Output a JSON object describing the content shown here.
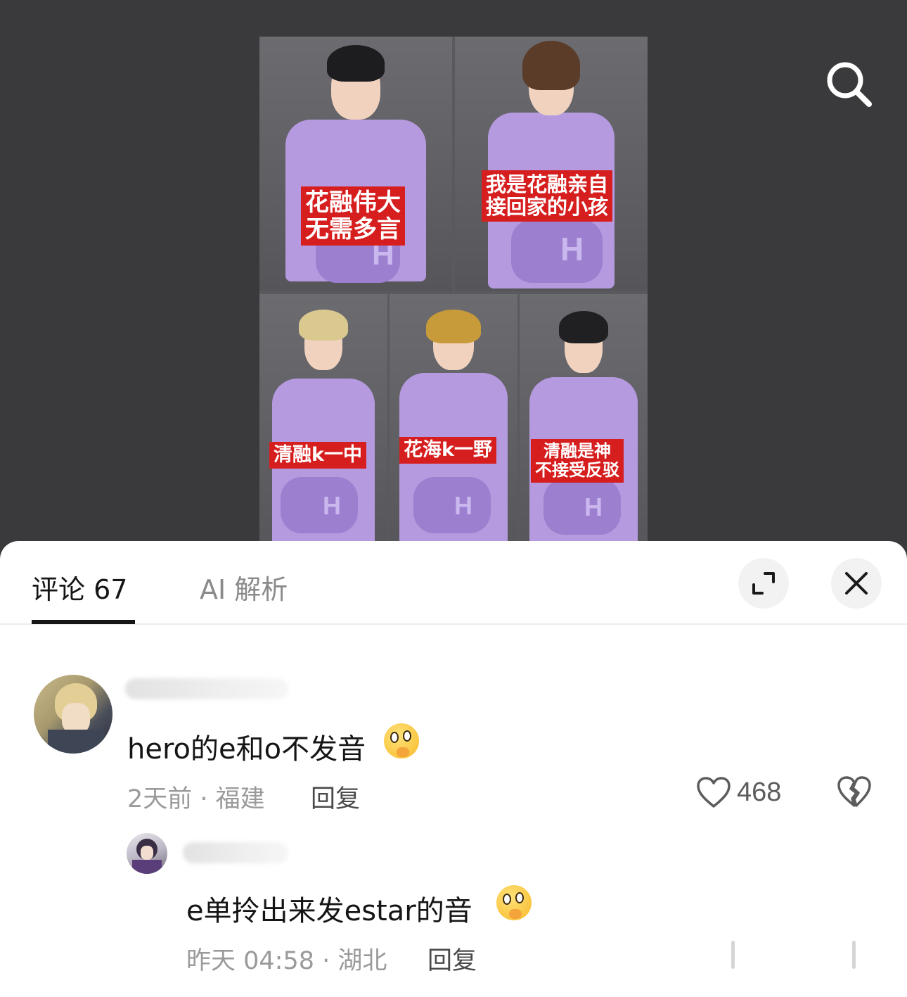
{
  "video": {
    "captions": [
      "花融伟大\n无需多言",
      "我是花融亲自\n接回家的小孩",
      "清融k一中",
      "花海k一野",
      "清融是神\n不接受反驳"
    ],
    "search_icon": "search-icon"
  },
  "comments_sheet": {
    "tabs": [
      {
        "label": "评论 67",
        "active": true
      },
      {
        "label": "AI 解析",
        "active": false
      }
    ],
    "expand_icon": "expand-icon",
    "close_icon": "close-icon"
  },
  "comments": [
    {
      "text": "hero的e和o不发音",
      "emoji": "thinking-face-emoji",
      "time": "2天前",
      "location": "福建",
      "meta": "2天前 · 福建",
      "reply_label": "回复",
      "likes": "468"
    },
    {
      "text": "e单拎出来发estar的音",
      "emoji": "thinking-face-emoji",
      "time": "昨天 04:58",
      "location": "湖北",
      "meta": "昨天 04:58 · 湖北",
      "reply_label": "回复"
    }
  ],
  "colors": {
    "caption_red": "#d61e1e",
    "jersey_purple": "#b69ae0",
    "background_dark": "#3a3a3c"
  }
}
